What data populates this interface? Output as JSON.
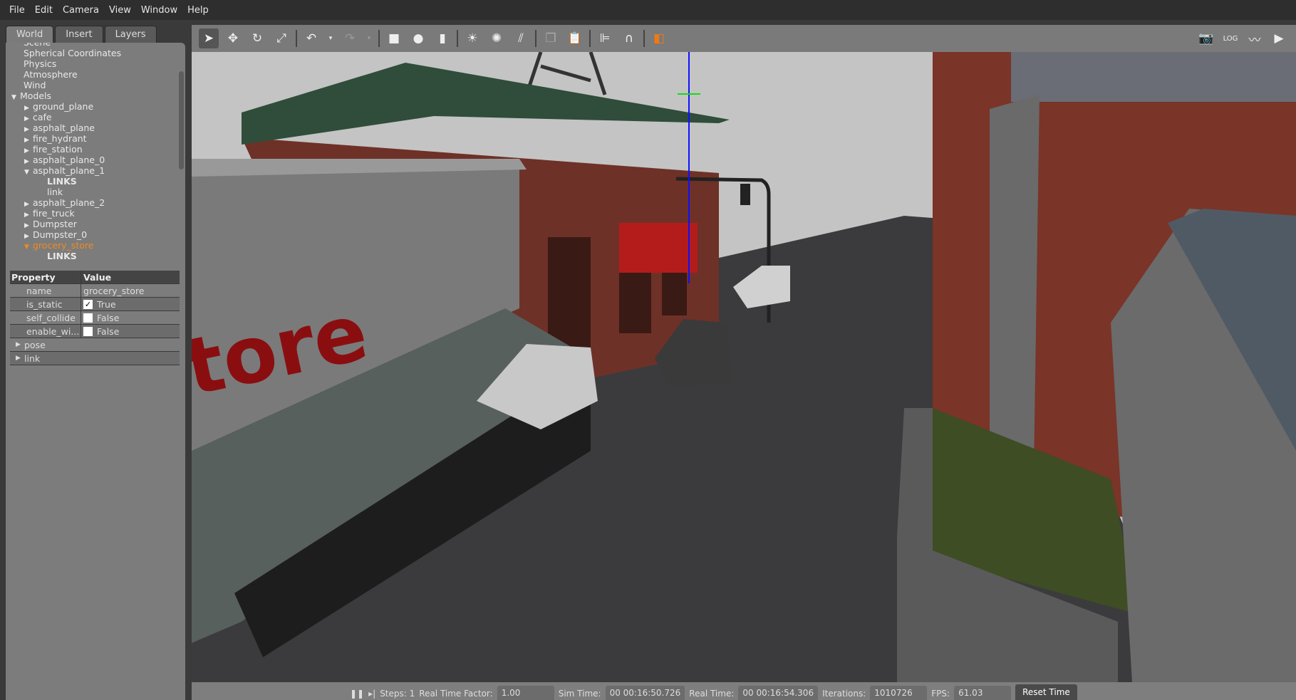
{
  "menu": [
    "File",
    "Edit",
    "Camera",
    "View",
    "Window",
    "Help"
  ],
  "tabs": [
    "World",
    "Insert",
    "Layers"
  ],
  "tree": [
    {
      "label": "Scene",
      "depth": 0,
      "arrow": ""
    },
    {
      "label": "Spherical Coordinates",
      "depth": 0,
      "arrow": ""
    },
    {
      "label": "Physics",
      "depth": 0,
      "arrow": ""
    },
    {
      "label": "Atmosphere",
      "depth": 0,
      "arrow": ""
    },
    {
      "label": "Wind",
      "depth": 0,
      "arrow": ""
    },
    {
      "label": "Models",
      "depth": 0,
      "arrow": "open"
    },
    {
      "label": "ground_plane",
      "depth": 1,
      "arrow": "closed"
    },
    {
      "label": "cafe",
      "depth": 1,
      "arrow": "closed"
    },
    {
      "label": "asphalt_plane",
      "depth": 1,
      "arrow": "closed"
    },
    {
      "label": "fire_hydrant",
      "depth": 1,
      "arrow": "closed"
    },
    {
      "label": "fire_station",
      "depth": 1,
      "arrow": "closed"
    },
    {
      "label": "asphalt_plane_0",
      "depth": 1,
      "arrow": "closed"
    },
    {
      "label": "asphalt_plane_1",
      "depth": 1,
      "arrow": "open"
    },
    {
      "label": "LINKS",
      "depth": 2,
      "arrow": "",
      "bold": true
    },
    {
      "label": "link",
      "depth": 2,
      "arrow": ""
    },
    {
      "label": "asphalt_plane_2",
      "depth": 1,
      "arrow": "closed"
    },
    {
      "label": "fire_truck",
      "depth": 1,
      "arrow": "closed"
    },
    {
      "label": "Dumpster",
      "depth": 1,
      "arrow": "closed"
    },
    {
      "label": "Dumpster_0",
      "depth": 1,
      "arrow": "closed"
    },
    {
      "label": "grocery_store",
      "depth": 1,
      "arrow": "open",
      "selected": true
    },
    {
      "label": "LINKS",
      "depth": 2,
      "arrow": "",
      "bold": true
    }
  ],
  "props": {
    "header": [
      "Property",
      "Value"
    ],
    "rows": [
      {
        "key": "name",
        "value": "grocery_store"
      },
      {
        "key": "is_static",
        "value": "True",
        "checked": true
      },
      {
        "key": "self_collide",
        "value": "False",
        "checked": false
      },
      {
        "key": "enable_wi...",
        "value": "False",
        "checked": false
      }
    ],
    "groups": [
      "pose",
      "link"
    ]
  },
  "toolbar": {
    "left": [
      "select-arrow",
      "translate",
      "rotate",
      "scale",
      "undo",
      "undo-dropdown",
      "redo",
      "redo-dropdown",
      "box",
      "sphere",
      "cylinder",
      "point-light",
      "spot-light",
      "directional-light",
      "copy",
      "paste",
      "align",
      "magnet",
      "view-angle"
    ],
    "right": [
      "screenshot",
      "log",
      "plot",
      "video"
    ]
  },
  "bottom": {
    "steps": "Steps: 1",
    "rtf_label": "Real Time Factor:",
    "rtf": "1.00",
    "sim_label": "Sim Time:",
    "sim": "00 00:16:50.726",
    "real_label": "Real Time:",
    "real": "00 00:16:54.306",
    "iter_label": "Iterations:",
    "iter": "1010726",
    "fps_label": "FPS:",
    "fps": "61.03",
    "reset": "Reset Time"
  },
  "scene": {
    "store_sign": "tore"
  },
  "colors": {
    "selected": "#f08a1c",
    "brick": "#7a3428",
    "sky": "#c6c6c6"
  }
}
